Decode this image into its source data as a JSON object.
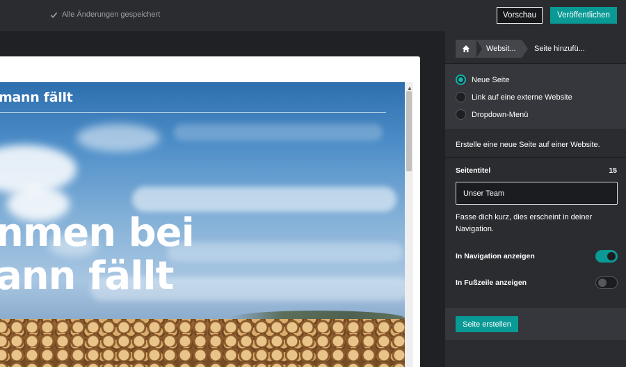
{
  "topbar": {
    "save_status": "Alle Änderungen gespeichert",
    "preview_label": "Vorschau",
    "publish_label": "Veröffentlichen"
  },
  "preview": {
    "top_title": "mann fällt",
    "headline_line1": "nmen bei",
    "headline_line2": "ann fällt"
  },
  "panel": {
    "breadcrumb": {
      "home_icon": "home-icon",
      "site": "Websit...",
      "current": "Seite hinzufü..."
    },
    "page_types": [
      {
        "label": "Neue Seite",
        "selected": true
      },
      {
        "label": "Link auf eine externe Website",
        "selected": false
      },
      {
        "label": "Dropdown-Menü",
        "selected": false
      }
    ],
    "description": "Erstelle eine neue Seite auf einer Website.",
    "title_field": {
      "label": "Seitentitel",
      "remaining": "15",
      "value": "Unser Team"
    },
    "hint": "Fasse dich kurz, dies erscheint in deiner Navigation.",
    "toggles": [
      {
        "label": "In Navigation anzeigen",
        "on": true
      },
      {
        "label": "In Fußzeile anzeigen",
        "on": false
      }
    ],
    "create_label": "Seite erstellen"
  },
  "colors": {
    "accent": "#0a9a96",
    "panel_bg": "#2b2c30",
    "topbar_bg": "#2b2c30"
  }
}
